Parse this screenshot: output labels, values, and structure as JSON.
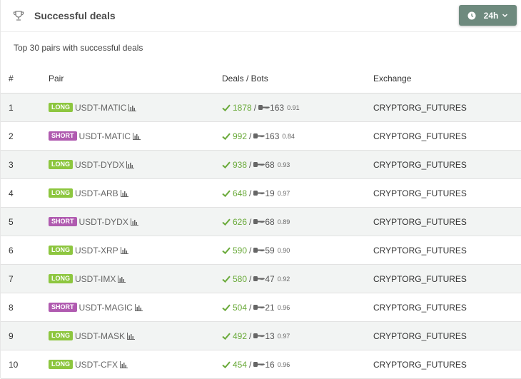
{
  "header": {
    "title": "Successful deals",
    "period": "24h"
  },
  "subtitle": "Top 30 pairs with successful deals",
  "table": {
    "columns": [
      "#",
      "Pair",
      "Deals / Bots",
      "Exchange"
    ],
    "rows": [
      {
        "n": "1",
        "dir": "LONG",
        "pair": "USDT-MATIC",
        "deals": "1878",
        "bots": "163",
        "ratio": "0.91",
        "exchange": "CRYPTORG_FUTURES"
      },
      {
        "n": "2",
        "dir": "SHORT",
        "pair": "USDT-MATIC",
        "deals": "992",
        "bots": "163",
        "ratio": "0.84",
        "exchange": "CRYPTORG_FUTURES"
      },
      {
        "n": "3",
        "dir": "LONG",
        "pair": "USDT-DYDX",
        "deals": "938",
        "bots": "68",
        "ratio": "0.93",
        "exchange": "CRYPTORG_FUTURES"
      },
      {
        "n": "4",
        "dir": "LONG",
        "pair": "USDT-ARB",
        "deals": "648",
        "bots": "19",
        "ratio": "0.97",
        "exchange": "CRYPTORG_FUTURES"
      },
      {
        "n": "5",
        "dir": "SHORT",
        "pair": "USDT-DYDX",
        "deals": "626",
        "bots": "68",
        "ratio": "0.89",
        "exchange": "CRYPTORG_FUTURES"
      },
      {
        "n": "6",
        "dir": "LONG",
        "pair": "USDT-XRP",
        "deals": "590",
        "bots": "59",
        "ratio": "0.90",
        "exchange": "CRYPTORG_FUTURES"
      },
      {
        "n": "7",
        "dir": "LONG",
        "pair": "USDT-IMX",
        "deals": "580",
        "bots": "47",
        "ratio": "0.92",
        "exchange": "CRYPTORG_FUTURES"
      },
      {
        "n": "8",
        "dir": "SHORT",
        "pair": "USDT-MAGIC",
        "deals": "504",
        "bots": "21",
        "ratio": "0.96",
        "exchange": "CRYPTORG_FUTURES"
      },
      {
        "n": "9",
        "dir": "LONG",
        "pair": "USDT-MASK",
        "deals": "492",
        "bots": "13",
        "ratio": "0.97",
        "exchange": "CRYPTORG_FUTURES"
      },
      {
        "n": "10",
        "dir": "LONG",
        "pair": "USDT-CFX",
        "deals": "454",
        "bots": "16",
        "ratio": "0.96",
        "exchange": "CRYPTORG_FUTURES"
      }
    ]
  },
  "icons": {
    "header": "trophy-icon",
    "period": "clock-icon",
    "dropdown": "chevron-down-icon",
    "chart": "bar-chart-icon",
    "deals": "check-icon",
    "bots": "key-icon"
  },
  "colors": {
    "long_badge": "#8dc63f",
    "short_badge": "#b05bb0",
    "deals_green": "#6aaa3a",
    "period_button": "#6e8a7e",
    "stripe": "#f2f4f3"
  }
}
